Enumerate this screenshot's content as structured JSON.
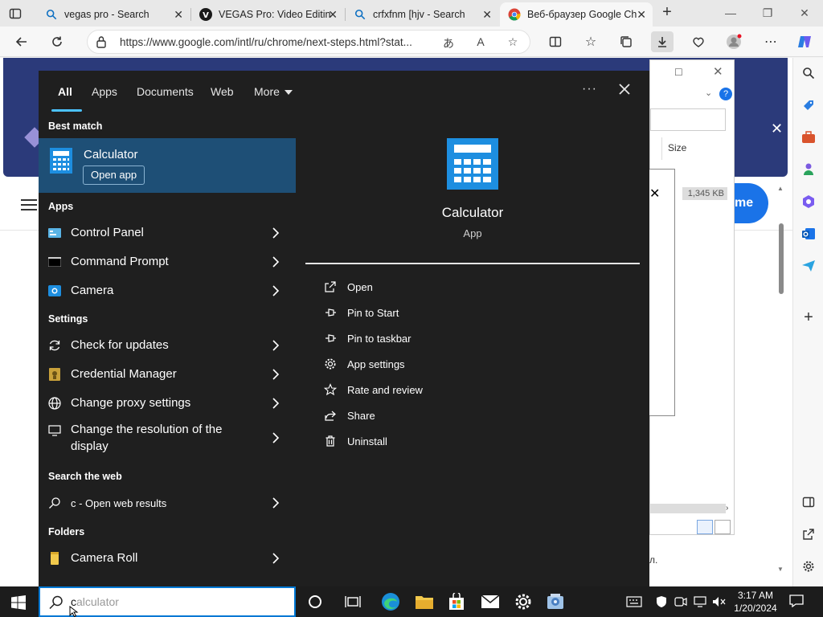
{
  "browser": {
    "tabs": [
      {
        "label": "vegas pro - Search",
        "icon": "search-icon"
      },
      {
        "label": "VEGAS Pro: Video Editin",
        "icon": "vegas-logo-icon"
      },
      {
        "label": "crfxfnm [hjv - Search",
        "icon": "search-icon"
      },
      {
        "label": "Веб-браузер Google Ch",
        "icon": "chrome-icon",
        "active": true
      }
    ],
    "url": "https://www.google.com/intl/ru/chrome/next-steps.html?stat..."
  },
  "page": {
    "button_fragment": "me",
    "text_fragment": "л."
  },
  "downloads_dialog": {
    "size_header": "Size",
    "row_size": "1,345 KB"
  },
  "search_panel": {
    "tabs": [
      {
        "label": "All",
        "active": true
      },
      {
        "label": "Apps"
      },
      {
        "label": "Documents"
      },
      {
        "label": "Web"
      },
      {
        "label": "More"
      }
    ],
    "best_match_header": "Best match",
    "best_match": {
      "name": "Calculator",
      "open_label": "Open app"
    },
    "apps_header": "Apps",
    "apps": [
      {
        "label": "Control Panel",
        "icon": "control-panel-icon"
      },
      {
        "label": "Command Prompt",
        "icon": "command-prompt-icon"
      },
      {
        "label": "Camera",
        "icon": "camera-icon"
      }
    ],
    "settings_header": "Settings",
    "settings": [
      {
        "label": "Check for updates",
        "icon": "sync-icon"
      },
      {
        "label": "Credential Manager",
        "icon": "credential-manager-icon"
      },
      {
        "label": "Change proxy settings",
        "icon": "globe-icon"
      },
      {
        "label": "Change the resolution of the display",
        "icon": "monitor-icon"
      }
    ],
    "web_header": "Search the web",
    "web_result": "c - Open web results",
    "folders_header": "Folders",
    "folders": [
      {
        "label": "Camera Roll",
        "icon": "folder-icon"
      }
    ],
    "detail": {
      "title": "Calculator",
      "type": "App",
      "actions": [
        {
          "label": "Open",
          "icon": "open-icon"
        },
        {
          "label": "Pin to Start",
          "icon": "pin-icon"
        },
        {
          "label": "Pin to taskbar",
          "icon": "pin-icon"
        },
        {
          "label": "App settings",
          "icon": "gear-icon"
        },
        {
          "label": "Rate and review",
          "icon": "star-icon"
        },
        {
          "label": "Share",
          "icon": "share-icon"
        },
        {
          "label": "Uninstall",
          "icon": "trash-icon"
        }
      ]
    }
  },
  "taskbar": {
    "search_typed": "c",
    "search_rest": "alculator",
    "time": "3:17 AM",
    "date": "1/20/2024"
  },
  "colors": {
    "accent": "#4cc2ff",
    "selected_row": "#1e4f76",
    "panel_bg": "#1f1f1f",
    "taskbar_bg": "#1c1c1c"
  }
}
